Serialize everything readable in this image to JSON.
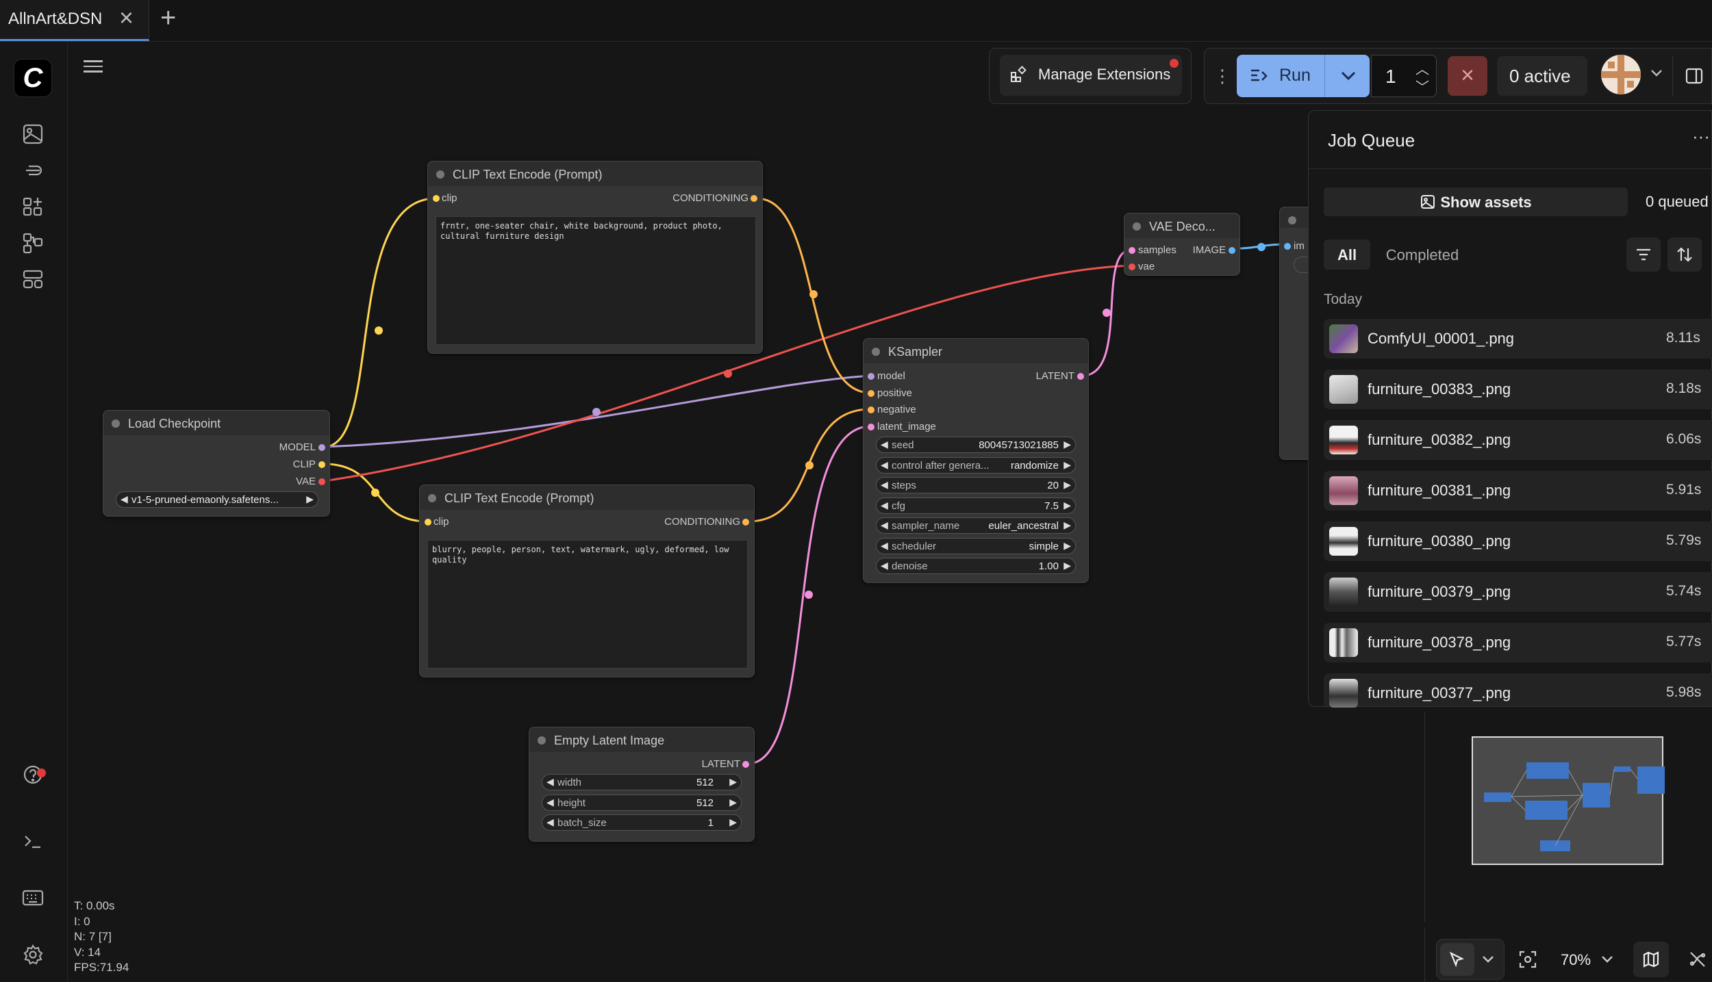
{
  "tab": {
    "title": "AllnArt&DSN"
  },
  "toolbar": {
    "manage_extensions": "Manage Extensions",
    "run_label": "Run",
    "batch_count": "1",
    "active_label": "0 active"
  },
  "nodes": {
    "clip_pos": {
      "title": "CLIP Text Encode (Prompt)",
      "in_clip": "clip",
      "out_cond": "CONDITIONING",
      "text": "frntr, one-seater chair, white background, product photo, cultural furniture design"
    },
    "clip_neg": {
      "title": "CLIP Text Encode (Prompt)",
      "in_clip": "clip",
      "out_cond": "CONDITIONING",
      "text": "blurry, people, person, text, watermark, ugly, deformed, low quality"
    },
    "checkpoint": {
      "title": "Load Checkpoint",
      "out_model": "MODEL",
      "out_clip": "CLIP",
      "out_vae": "VAE",
      "ckpt": "v1-5-pruned-emaonly.safetens..."
    },
    "ksampler": {
      "title": "KSampler",
      "in_model": "model",
      "in_positive": "positive",
      "in_negative": "negative",
      "in_latent": "latent_image",
      "out_latent": "LATENT",
      "seed_label": "seed",
      "seed": "80045713021885",
      "control_label": "control after genera...",
      "control": "randomize",
      "steps_label": "steps",
      "steps": "20",
      "cfg_label": "cfg",
      "cfg": "7.5",
      "sampler_label": "sampler_name",
      "sampler": "euler_ancestral",
      "scheduler_label": "scheduler",
      "scheduler": "simple",
      "denoise_label": "denoise",
      "denoise": "1.00"
    },
    "vae": {
      "title": "VAE Deco...",
      "in_samples": "samples",
      "in_vae": "vae",
      "out_image": "IMAGE"
    },
    "save": {
      "partial": "im"
    },
    "latent": {
      "title": "Empty Latent Image",
      "out_latent": "LATENT",
      "width_label": "width",
      "width": "512",
      "height_label": "height",
      "height": "512",
      "batch_label": "batch_size",
      "batch": "1"
    }
  },
  "job_queue": {
    "title": "Job Queue",
    "show_assets": "Show assets",
    "queued": "0 queued",
    "filter_all": "All",
    "filter_completed": "Completed",
    "group": "Today",
    "items": [
      {
        "name": "ComfyUI_00001_.png",
        "time": "8.11s"
      },
      {
        "name": "furniture_00383_.png",
        "time": "8.18s"
      },
      {
        "name": "furniture_00382_.png",
        "time": "6.06s"
      },
      {
        "name": "furniture_00381_.png",
        "time": "5.91s"
      },
      {
        "name": "furniture_00380_.png",
        "time": "5.79s"
      },
      {
        "name": "furniture_00379_.png",
        "time": "5.74s"
      },
      {
        "name": "furniture_00378_.png",
        "time": "5.77s"
      },
      {
        "name": "furniture_00377_.png",
        "time": "5.98s"
      }
    ]
  },
  "canvas_controls": {
    "zoom": "70%"
  },
  "stats": {
    "t": "T: 0.00s",
    "i": "I: 0",
    "n": "N: 7 [7]",
    "v": "V: 14",
    "fps": "FPS:71.94"
  },
  "colors": {
    "model": "#b39ddb",
    "clip": "#ffd54f",
    "vae": "#ef5350",
    "conditioning": "#ffb74d",
    "latent": "#f48fde",
    "image": "#64b5f6",
    "accent": "#5c8fe0"
  }
}
